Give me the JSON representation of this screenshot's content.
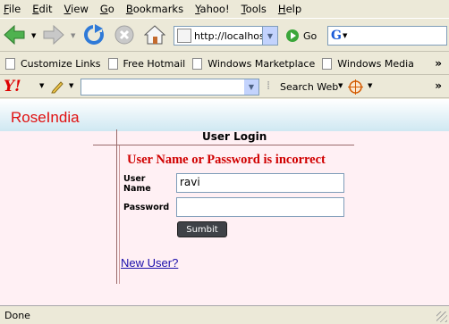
{
  "menu": {
    "items": [
      {
        "key": "F",
        "rest": "ile"
      },
      {
        "key": "E",
        "rest": "dit"
      },
      {
        "key": "V",
        "rest": "iew"
      },
      {
        "key": "G",
        "rest": "o"
      },
      {
        "key": "B",
        "rest": "ookmarks"
      },
      {
        "key": "Y",
        "rest": "ahoo!"
      },
      {
        "key": "T",
        "rest": "ools"
      },
      {
        "key": "H",
        "rest": "elp"
      }
    ]
  },
  "navbar": {
    "address_value": "http://localhost",
    "go_label": "Go",
    "search_engine_letter": "G"
  },
  "bookmarks": {
    "items": [
      "Customize Links",
      "Free Hotmail",
      "Windows Marketplace",
      "Windows Media"
    ],
    "overflow": "»"
  },
  "yahoo_bar": {
    "logo": "Y!",
    "search_value": "",
    "search_web_label": "Search Web",
    "overflow": "»"
  },
  "page": {
    "brand": "RoseIndia",
    "login_title": "User Login",
    "error_message": "User Name or Password is incorrect",
    "username_label_line1": "User",
    "username_label_line2": "Name",
    "username_value": "ravi",
    "password_label": "Password",
    "password_value": "",
    "submit_label": "Sumbit",
    "new_user_link": "New User?"
  },
  "status": {
    "text": "Done"
  },
  "colors": {
    "brand": "#e01010",
    "error": "#d00000",
    "page_bg": "#fff0f4",
    "link": "#1a0dab"
  }
}
